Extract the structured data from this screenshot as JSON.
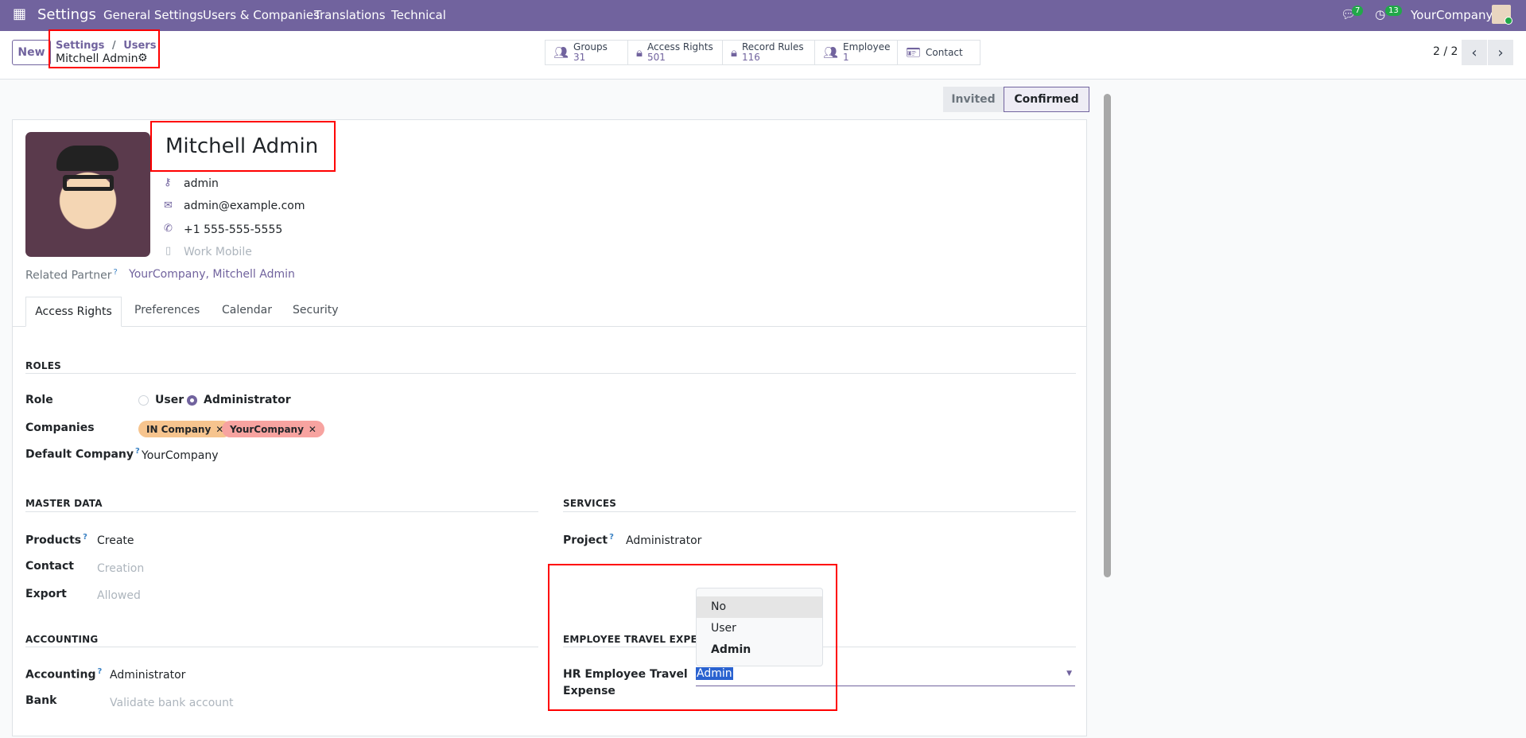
{
  "navbar": {
    "app_title": "Settings",
    "menu": [
      "General Settings",
      "Users & Companies",
      "Translations",
      "Technical"
    ],
    "chat_badge": "7",
    "activity_badge": "13",
    "company": "YourCompany"
  },
  "control_panel": {
    "new_label": "New",
    "breadcrumb_parent": "Settings",
    "breadcrumb_sep": "/",
    "breadcrumb_section": "Users",
    "record_name": "Mitchell Admin",
    "pager": "2 / 2",
    "smart_buttons": [
      {
        "label": "Groups",
        "count": "31"
      },
      {
        "label": "Access Rights",
        "count": "501"
      },
      {
        "label": "Record Rules",
        "count": "116"
      },
      {
        "label": "Employee",
        "count": "1"
      },
      {
        "label": "Contact",
        "count": ""
      }
    ]
  },
  "status": {
    "steps": [
      "Invited",
      "Confirmed"
    ],
    "active": "Confirmed"
  },
  "user": {
    "name": "Mitchell Admin",
    "login": "admin",
    "email": "admin@example.com",
    "phone": "+1 555-555-5555",
    "mobile_placeholder": "Work Mobile",
    "related_partner_label": "Related Partner",
    "related_partner": "YourCompany, Mitchell Admin",
    "help": "?"
  },
  "tabs": [
    "Access Rights",
    "Preferences",
    "Calendar",
    "Security"
  ],
  "roles": {
    "title": "ROLES",
    "role_label": "Role",
    "options": [
      "User",
      "Administrator"
    ],
    "selected": "Administrator",
    "companies_label": "Companies",
    "companies": [
      "IN Company",
      "YourCompany"
    ],
    "default_company_label": "Default Company",
    "default_company": "YourCompany"
  },
  "master_data": {
    "title": "MASTER DATA",
    "rows": [
      {
        "label": "Products",
        "value": "Create",
        "placeholder": false
      },
      {
        "label": "Contact",
        "value": "Creation",
        "placeholder": true
      },
      {
        "label": "Export",
        "value": "Allowed",
        "placeholder": true
      }
    ]
  },
  "services": {
    "title": "SERVICES",
    "project_label": "Project",
    "project_value": "Administrator"
  },
  "accounting": {
    "title": "ACCOUNTING",
    "rows": [
      {
        "label": "Accounting",
        "value": "Administrator",
        "placeholder": false
      },
      {
        "label": "Bank",
        "value": "Validate bank account",
        "placeholder": true
      }
    ]
  },
  "travel": {
    "title": "EMPLOYEE TRAVEL EXPENSE",
    "label_line1": "HR Employee Travel",
    "label_line2": "Expense",
    "value": "Admin",
    "options": [
      "No",
      "User",
      "Admin"
    ]
  }
}
